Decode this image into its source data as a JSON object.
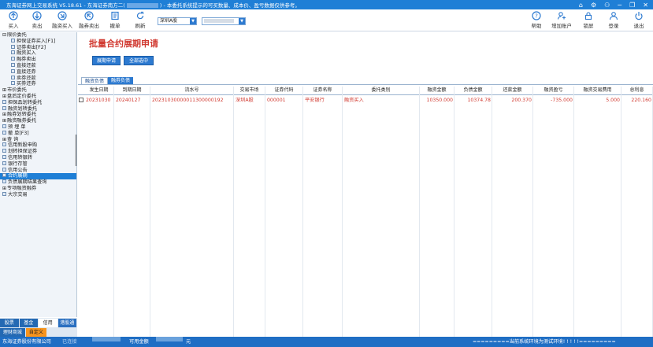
{
  "window": {
    "title": "东海证券网上交易系统 V5.18.61 - 东海证券南方二(",
    "title_suffix": ") - 本委托系统提示的可买数量、成本价、盈亏数据仅供参考。",
    "controls": [
      "⌂",
      "⚙",
      "⚇",
      "─",
      "❐",
      "✕"
    ]
  },
  "toolbar": {
    "left": [
      {
        "label": "买入",
        "icon": "buy-icon"
      },
      {
        "label": "卖出",
        "icon": "sell-icon"
      },
      {
        "label": "融资买入",
        "icon": "margin-buy-icon"
      },
      {
        "label": "融券卖出",
        "icon": "short-sell-icon"
      },
      {
        "label": "撤单",
        "icon": "cancel-order-icon"
      },
      {
        "label": "刷新",
        "icon": "refresh-icon"
      }
    ],
    "market_select": "深圳A股",
    "account_select": "",
    "right": [
      {
        "label": "帮助",
        "icon": "help-icon"
      },
      {
        "label": "增加账户",
        "icon": "add-account-icon"
      },
      {
        "label": "锁屏",
        "icon": "lock-icon"
      },
      {
        "label": "登录",
        "icon": "login-icon"
      },
      {
        "label": "退出",
        "icon": "exit-icon"
      }
    ]
  },
  "sidebar": {
    "items": [
      {
        "label": "限价委托",
        "indent": 0,
        "expand": "⊟"
      },
      {
        "label": "担保证券买入[F1]",
        "indent": 1
      },
      {
        "label": "证券卖出[F2]",
        "indent": 1
      },
      {
        "label": "融资买入",
        "indent": 1
      },
      {
        "label": "融券卖出",
        "indent": 1
      },
      {
        "label": "直接还款",
        "indent": 1
      },
      {
        "label": "直接还券",
        "indent": 1
      },
      {
        "label": "卖券还款",
        "indent": 1
      },
      {
        "label": "买券还券",
        "indent": 1
      },
      {
        "label": "市价委托",
        "indent": 0,
        "expand": "⊞"
      },
      {
        "label": "盘后定价委托",
        "indent": 0,
        "expand": "⊞"
      },
      {
        "label": "担保品划转委托",
        "indent": 0
      },
      {
        "label": "融资划转委托",
        "indent": 0
      },
      {
        "label": "融券划转委托",
        "indent": 0,
        "expand": "⊞"
      },
      {
        "label": "融资融券委托",
        "indent": 0,
        "expand": "⊞"
      },
      {
        "label": "预 埋 单",
        "indent": 0
      },
      {
        "label": "撤    单[F3]",
        "indent": 0
      },
      {
        "label": "查    询",
        "indent": 0,
        "expand": "⊞"
      },
      {
        "label": "信用新股申购",
        "indent": 0
      },
      {
        "label": "划转担保证券",
        "indent": 0
      },
      {
        "label": "信用转银转",
        "indent": 0
      },
      {
        "label": "银行存管",
        "indent": 0
      },
      {
        "label": "信用公告",
        "indent": 0
      },
      {
        "label": "合约展期",
        "indent": 0,
        "selected": true
      },
      {
        "label": "负债展期结果查询",
        "indent": 0
      },
      {
        "label": "专项融资融券",
        "indent": 0,
        "expand": "⊞"
      },
      {
        "label": "大宗交易",
        "indent": 0
      }
    ],
    "bottom_tabs_row1": [
      "股票",
      "基金",
      "信用",
      "港股通"
    ],
    "bottom_tabs_row2": [
      "理财商城",
      "自定义"
    ]
  },
  "main": {
    "title": "批量合约展期申请",
    "buttons": [
      "展期申请",
      "全部选中"
    ],
    "subtabs": [
      "融资负债",
      "融券负债"
    ],
    "columns": [
      "发生日期",
      "到期日期",
      "流水号",
      "交易市场",
      "证券代码",
      "证券名称",
      "委托类别",
      "融资金额",
      "负债金额",
      "还款金额",
      "融资盈亏",
      "融资交易费用",
      "总利息"
    ],
    "rows": [
      [
        "20231030",
        "20240127",
        "20231030000011300000192",
        "深圳A股",
        "000001",
        "平安银行",
        "融资买入",
        "10350.000",
        "10374.78",
        "200.370",
        "-735.000",
        "5.000",
        "220.160"
      ]
    ]
  },
  "statusbar": {
    "company": "东海证券股份有限公司",
    "status": "已连接",
    "available_label": "可用金额",
    "currency": "元",
    "notice": "=========当前系统环境为测试环境! ! ! ! !========="
  }
}
